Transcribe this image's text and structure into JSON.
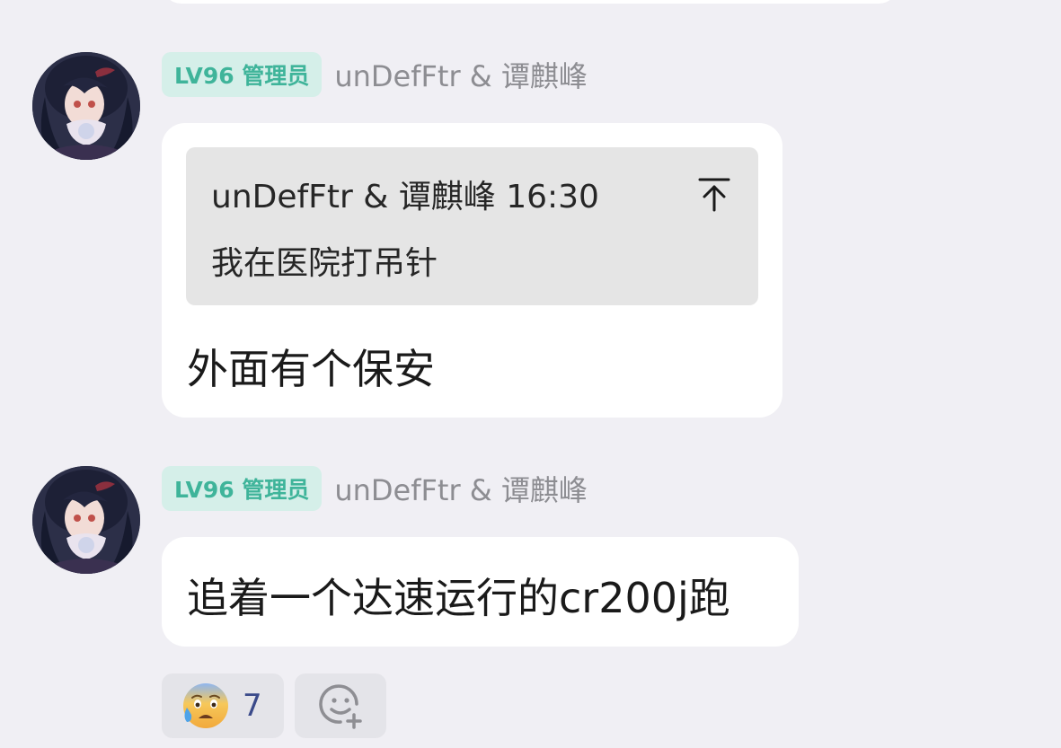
{
  "messages": [
    {
      "badge": "LV96 管理员",
      "sender": "unDefFtr & 谭麒峰",
      "quote": {
        "author_time": "unDefFtr & 谭麒峰 16:30",
        "text": "我在医院打吊针"
      },
      "text": "外面有个保安"
    },
    {
      "badge": "LV96 管理员",
      "sender": "unDefFtr & 谭麒峰",
      "text": "追着一个达速运行的cr200j跑"
    }
  ],
  "reactions": {
    "emoji_name": "anxious-face-with-sweat",
    "count": "7",
    "add_icon": "add-reaction-icon"
  },
  "colors": {
    "background": "#f0eff4",
    "badge_bg": "#d5efe9",
    "badge_text": "#3fb49a",
    "quote_bg": "#e5e5e5",
    "username": "#8d8d92"
  }
}
